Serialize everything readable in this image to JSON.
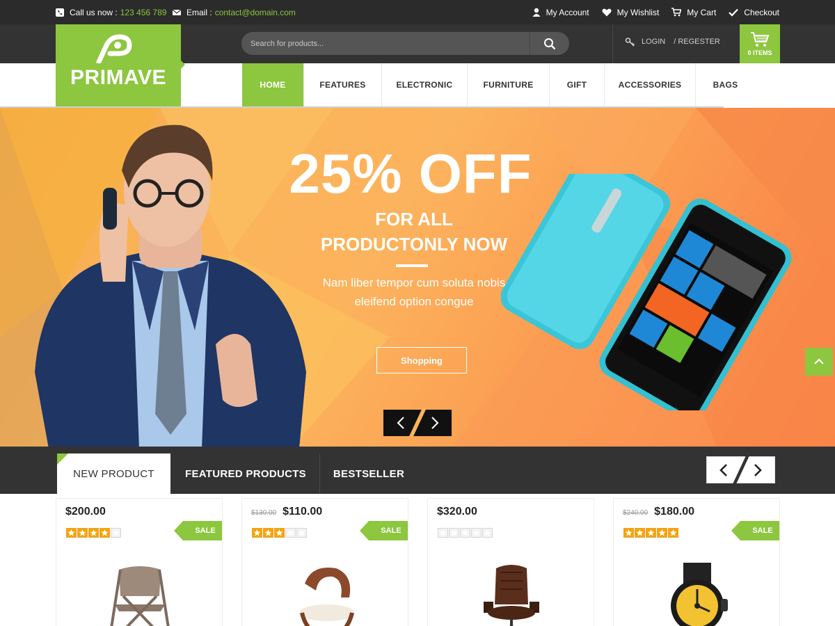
{
  "topbar": {
    "phone_label": "Call us now :",
    "phone_value": "123 456 789",
    "email_label": "Email :",
    "email_value": "contact@domain.com",
    "links": [
      {
        "label": "My Account",
        "icon": "user-icon"
      },
      {
        "label": "My Wishlist",
        "icon": "heart-icon"
      },
      {
        "label": "My Cart",
        "icon": "cart-icon"
      },
      {
        "label": "Checkout",
        "icon": "check-icon"
      }
    ]
  },
  "header": {
    "logo_text": "PRIMAVE",
    "search_placeholder": "Search for products...",
    "login_label": "LOGIN",
    "register_label": "/ REGESTER",
    "cart_count": "0 ITEMS"
  },
  "nav": {
    "items": [
      "HOME",
      "FEATURES",
      "ELECTRONIC",
      "FURNITURE",
      "GIFT",
      "ACCESSORIES",
      "BAGS"
    ],
    "active": "HOME"
  },
  "hero": {
    "headline": "25% OFF",
    "subline1": "FOR ALL",
    "subline2": "PRODUCTONLY NOW",
    "body": "Nam liber tempor cum soluta nobis eleifend option congue",
    "button_label": "Shopping"
  },
  "tabs": {
    "items": [
      "NEW PRODUCT",
      "FEATURED PRODUCTS",
      "BESTSELLER"
    ],
    "active": "NEW PRODUCT"
  },
  "products": [
    {
      "old_price": "",
      "price": "$200.00",
      "rating": 4,
      "sale": true,
      "sale_label": "SALE",
      "image": "folding-chair"
    },
    {
      "old_price": "$130.00",
      "price": "$110.00",
      "rating": 3,
      "sale": true,
      "sale_label": "SALE",
      "image": "wooden-chair"
    },
    {
      "old_price": "",
      "price": "$320.00",
      "rating": 0,
      "sale": false,
      "sale_label": "",
      "image": "office-chair"
    },
    {
      "old_price": "$240.00",
      "price": "$180.00",
      "rating": 5,
      "sale": true,
      "sale_label": "SALE",
      "image": "wrist-watch"
    }
  ],
  "colors": {
    "accent": "#8dc63f",
    "topbar": "#2b2b2b",
    "header": "#333333",
    "star": "#f7a500"
  }
}
